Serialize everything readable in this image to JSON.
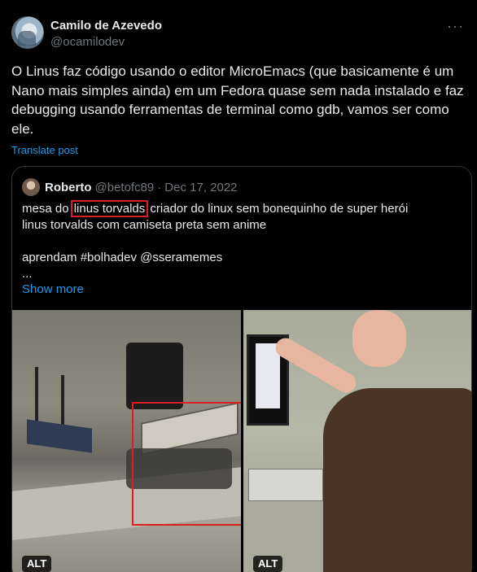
{
  "author": {
    "display_name": "Camilo de Azevedo",
    "handle": "@ocamilodev"
  },
  "more_icon": "more-horizontal-icon",
  "tweet_text": "O Linus faz código usando o editor MicroEmacs (que basicamente é um Nano mais simples ainda) em um Fedora quase sem nada instalado e faz debugging usando ferramentas de terminal como gdb, vamos ser como ele.",
  "translate_label": "Translate post",
  "quote": {
    "name": "Roberto",
    "handle": "@betofc89",
    "dot": "·",
    "date": "Dec 17, 2022",
    "line1_before": "mesa do ",
    "line1_highlight": "linus torvalds",
    "line1_after": " criador do linux sem bonequinho de super herói",
    "line2": "linus torvalds com camiseta preta sem anime",
    "line3": "aprendam #bolhadev @sseramemes",
    "line4": "...",
    "show_more": "Show more",
    "media": [
      {
        "alt_badge": "ALT"
      },
      {
        "alt_badge": "ALT"
      }
    ]
  },
  "colors": {
    "background": "#000000",
    "text": "#e7e9ea",
    "muted": "#71767b",
    "link": "#1d9bf0",
    "annotation_red": "#d91f1f"
  }
}
